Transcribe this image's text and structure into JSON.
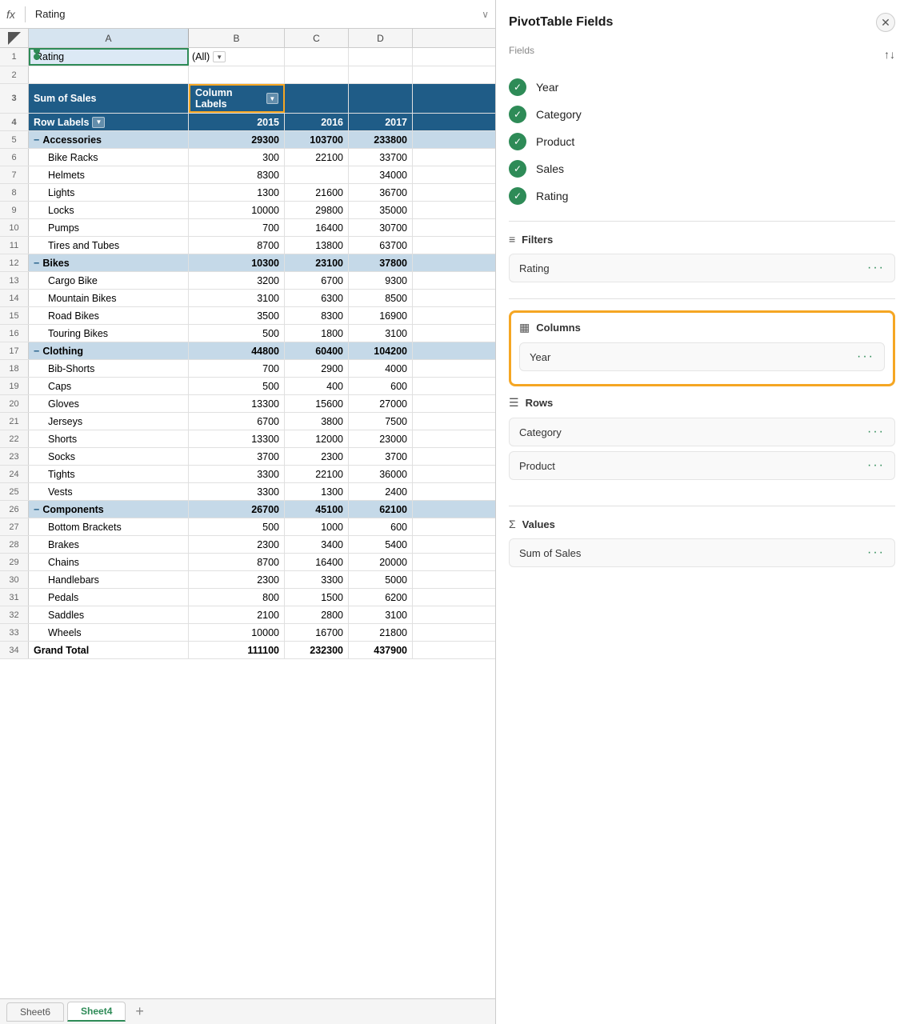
{
  "formula_bar": {
    "icon": "fx",
    "content": "Rating",
    "arrow": "∨"
  },
  "columns": {
    "a_label": "A",
    "b_label": "B",
    "c_label": "C",
    "d_label": "D"
  },
  "rows": [
    {
      "num": "1",
      "type": "filter",
      "a": "Rating",
      "b": "(All)",
      "c": "",
      "d": ""
    },
    {
      "num": "2",
      "type": "empty",
      "a": "",
      "b": "",
      "c": "",
      "d": ""
    },
    {
      "num": "3",
      "type": "header-blue",
      "a": "Sum of Sales",
      "b": "Column Labels",
      "c": "",
      "d": ""
    },
    {
      "num": "4",
      "type": "header-blue",
      "a": "Row Labels",
      "b": "2015",
      "c": "2016",
      "d": "2017"
    },
    {
      "num": "5",
      "type": "category",
      "a": "Accessories",
      "b": "29300",
      "c": "103700",
      "d": "233800"
    },
    {
      "num": "6",
      "type": "data",
      "a": "Bike Racks",
      "b": "300",
      "c": "22100",
      "d": "33700"
    },
    {
      "num": "7",
      "type": "data",
      "a": "Helmets",
      "b": "8300",
      "c": "",
      "d": "34000"
    },
    {
      "num": "8",
      "type": "data",
      "a": "Lights",
      "b": "1300",
      "c": "21600",
      "d": "36700"
    },
    {
      "num": "9",
      "type": "data",
      "a": "Locks",
      "b": "10000",
      "c": "29800",
      "d": "35000"
    },
    {
      "num": "10",
      "type": "data",
      "a": "Pumps",
      "b": "700",
      "c": "16400",
      "d": "30700"
    },
    {
      "num": "11",
      "type": "data",
      "a": "Tires and Tubes",
      "b": "8700",
      "c": "13800",
      "d": "63700"
    },
    {
      "num": "12",
      "type": "category",
      "a": "Bikes",
      "b": "10300",
      "c": "23100",
      "d": "37800"
    },
    {
      "num": "13",
      "type": "data",
      "a": "Cargo Bike",
      "b": "3200",
      "c": "6700",
      "d": "9300"
    },
    {
      "num": "14",
      "type": "data",
      "a": "Mountain Bikes",
      "b": "3100",
      "c": "6300",
      "d": "8500"
    },
    {
      "num": "15",
      "type": "data",
      "a": "Road Bikes",
      "b": "3500",
      "c": "8300",
      "d": "16900"
    },
    {
      "num": "16",
      "type": "data",
      "a": "Touring Bikes",
      "b": "500",
      "c": "1800",
      "d": "3100"
    },
    {
      "num": "17",
      "type": "category",
      "a": "Clothing",
      "b": "44800",
      "c": "60400",
      "d": "104200"
    },
    {
      "num": "18",
      "type": "data",
      "a": "Bib-Shorts",
      "b": "700",
      "c": "2900",
      "d": "4000"
    },
    {
      "num": "19",
      "type": "data",
      "a": "Caps",
      "b": "500",
      "c": "400",
      "d": "600"
    },
    {
      "num": "20",
      "type": "data",
      "a": "Gloves",
      "b": "13300",
      "c": "15600",
      "d": "27000"
    },
    {
      "num": "21",
      "type": "data",
      "a": "Jerseys",
      "b": "6700",
      "c": "3800",
      "d": "7500"
    },
    {
      "num": "22",
      "type": "data",
      "a": "Shorts",
      "b": "13300",
      "c": "12000",
      "d": "23000"
    },
    {
      "num": "23",
      "type": "data",
      "a": "Socks",
      "b": "3700",
      "c": "2300",
      "d": "3700"
    },
    {
      "num": "24",
      "type": "data",
      "a": "Tights",
      "b": "3300",
      "c": "22100",
      "d": "36000"
    },
    {
      "num": "25",
      "type": "data",
      "a": "Vests",
      "b": "3300",
      "c": "1300",
      "d": "2400"
    },
    {
      "num": "26",
      "type": "category",
      "a": "Components",
      "b": "26700",
      "c": "45100",
      "d": "62100"
    },
    {
      "num": "27",
      "type": "data",
      "a": "Bottom Brackets",
      "b": "500",
      "c": "1000",
      "d": "600"
    },
    {
      "num": "28",
      "type": "data",
      "a": "Brakes",
      "b": "2300",
      "c": "3400",
      "d": "5400"
    },
    {
      "num": "29",
      "type": "data",
      "a": "Chains",
      "b": "8700",
      "c": "16400",
      "d": "20000"
    },
    {
      "num": "30",
      "type": "data",
      "a": "Handlebars",
      "b": "2300",
      "c": "3300",
      "d": "5000"
    },
    {
      "num": "31",
      "type": "data",
      "a": "Pedals",
      "b": "800",
      "c": "1500",
      "d": "6200"
    },
    {
      "num": "32",
      "type": "data",
      "a": "Saddles",
      "b": "2100",
      "c": "2800",
      "d": "3100"
    },
    {
      "num": "33",
      "type": "data",
      "a": "Wheels",
      "b": "10000",
      "c": "16700",
      "d": "21800"
    },
    {
      "num": "34",
      "type": "grand-total",
      "a": "Grand Total",
      "b": "111100",
      "c": "232300",
      "d": "437900"
    }
  ],
  "sheet_tabs": [
    {
      "name": "Sheet6",
      "active": false
    },
    {
      "name": "Sheet4",
      "active": true
    }
  ],
  "pivot_panel": {
    "title": "PivotTable Fields",
    "close_label": "✕",
    "fields_label": "Fields",
    "sort_icon": "↑↓",
    "fields": [
      {
        "name": "Year",
        "checked": true
      },
      {
        "name": "Category",
        "checked": true
      },
      {
        "name": "Product",
        "checked": true
      },
      {
        "name": "Sales",
        "checked": true
      },
      {
        "name": "Rating",
        "checked": true
      }
    ],
    "filters_label": "Filters",
    "filters_items": [
      {
        "name": "Rating"
      }
    ],
    "columns_label": "Columns",
    "columns_items": [
      {
        "name": "Year"
      }
    ],
    "rows_label": "Rows",
    "rows_items": [
      {
        "name": "Category"
      },
      {
        "name": "Product"
      }
    ],
    "values_label": "Values",
    "values_items": [
      {
        "name": "Sum of Sales"
      }
    ]
  }
}
